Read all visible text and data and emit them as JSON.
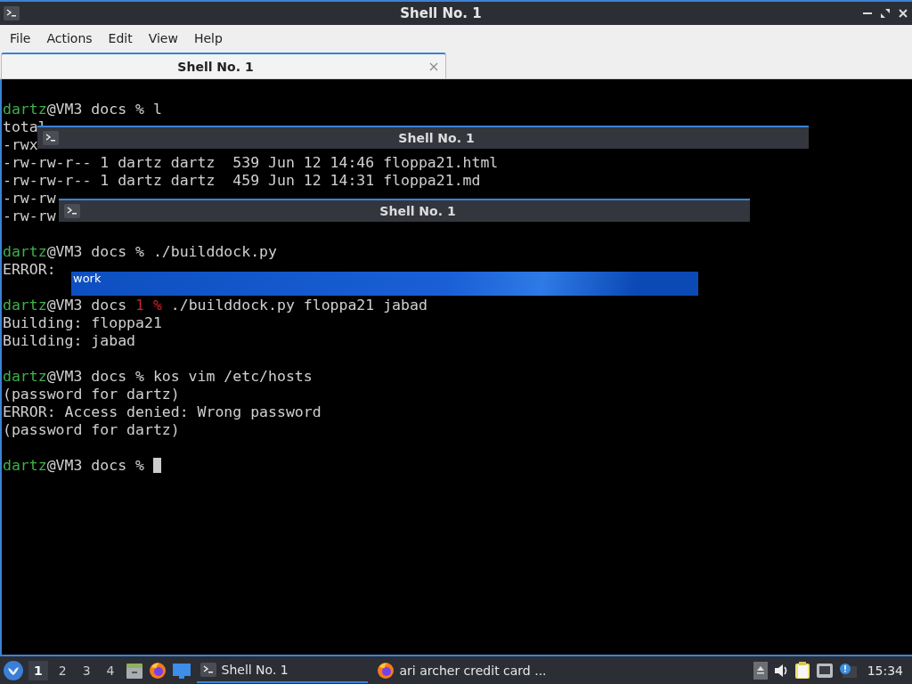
{
  "window": {
    "title": "Shell No. 1"
  },
  "menu": [
    "File",
    "Actions",
    "Edit",
    "View",
    "Help"
  ],
  "tabs": [
    {
      "label": "Shell No. 1",
      "selected": true
    }
  ],
  "terminal": {
    "lines": [
      {
        "kind": "blank"
      },
      {
        "kind": "text",
        "parts": [
          {
            "kind": "user",
            "text": "dartz"
          },
          {
            "kind": "plain",
            "text": "@VM3 docs % l"
          }
        ]
      },
      {
        "kind": "text",
        "parts": [
          {
            "kind": "plain",
            "text": "total"
          }
        ]
      },
      {
        "kind": "text",
        "parts": [
          {
            "kind": "plain",
            "text": "-rwx"
          }
        ]
      },
      {
        "kind": "text",
        "parts": [
          {
            "kind": "plain",
            "text": "-rw-rw-r-- 1 dartz dartz  539 Jun 12 14:46 floppa21.html"
          }
        ]
      },
      {
        "kind": "text",
        "parts": [
          {
            "kind": "plain",
            "text": "-rw-rw-r-- 1 dartz dartz  459 Jun 12 14:31 floppa21.md"
          }
        ]
      },
      {
        "kind": "text",
        "parts": [
          {
            "kind": "plain",
            "text": "-rw-rw"
          }
        ]
      },
      {
        "kind": "text",
        "parts": [
          {
            "kind": "plain",
            "text": "-rw-rw"
          }
        ]
      },
      {
        "kind": "blank"
      },
      {
        "kind": "text",
        "parts": [
          {
            "kind": "user",
            "text": "dartz"
          },
          {
            "kind": "plain",
            "text": "@VM3 docs % ./builddock.py"
          }
        ]
      },
      {
        "kind": "text",
        "parts": [
          {
            "kind": "plain",
            "text": "ERROR:"
          }
        ]
      },
      {
        "kind": "blank"
      },
      {
        "kind": "text",
        "parts": [
          {
            "kind": "user",
            "text": "dartz"
          },
          {
            "kind": "plain",
            "text": "@VM3 docs "
          },
          {
            "kind": "status",
            "text": "1 %"
          },
          {
            "kind": "plain",
            "text": " ./builddock.py floppa21 jabad"
          }
        ]
      },
      {
        "kind": "text",
        "parts": [
          {
            "kind": "plain",
            "text": "Building: floppa21"
          }
        ]
      },
      {
        "kind": "text",
        "parts": [
          {
            "kind": "plain",
            "text": "Building: jabad"
          }
        ]
      },
      {
        "kind": "blank"
      },
      {
        "kind": "text",
        "parts": [
          {
            "kind": "user",
            "text": "dartz"
          },
          {
            "kind": "plain",
            "text": "@VM3 docs % kos vim /etc/hosts"
          }
        ]
      },
      {
        "kind": "text",
        "parts": [
          {
            "kind": "plain",
            "text": "(password for dartz)"
          }
        ]
      },
      {
        "kind": "text",
        "parts": [
          {
            "kind": "plain",
            "text": "ERROR: Access denied: Wrong password"
          }
        ]
      },
      {
        "kind": "text",
        "parts": [
          {
            "kind": "plain",
            "text": "(password for dartz)"
          }
        ]
      },
      {
        "kind": "blank"
      },
      {
        "kind": "text",
        "parts": [
          {
            "kind": "user",
            "text": "dartz"
          },
          {
            "kind": "plain",
            "text": "@VM3 docs % "
          },
          {
            "kind": "cursor"
          }
        ]
      }
    ]
  },
  "ghosts": [
    {
      "kind": "titlebar",
      "title": "Shell No. 1"
    },
    {
      "kind": "titlebar",
      "title": "Shell No. 1"
    },
    {
      "kind": "selection",
      "title": "work"
    }
  ],
  "taskbar": {
    "workspaces": [
      {
        "label": "1",
        "selected": true
      },
      {
        "label": "2",
        "selected": false
      },
      {
        "label": "3",
        "selected": false
      },
      {
        "label": "4",
        "selected": false
      }
    ],
    "tasks": [
      {
        "label": "Shell No. 1",
        "kind": "terminal",
        "selected": true
      },
      {
        "label": "ari archer credit card ...",
        "kind": "browser",
        "selected": false
      }
    ],
    "clock": "15:34"
  }
}
